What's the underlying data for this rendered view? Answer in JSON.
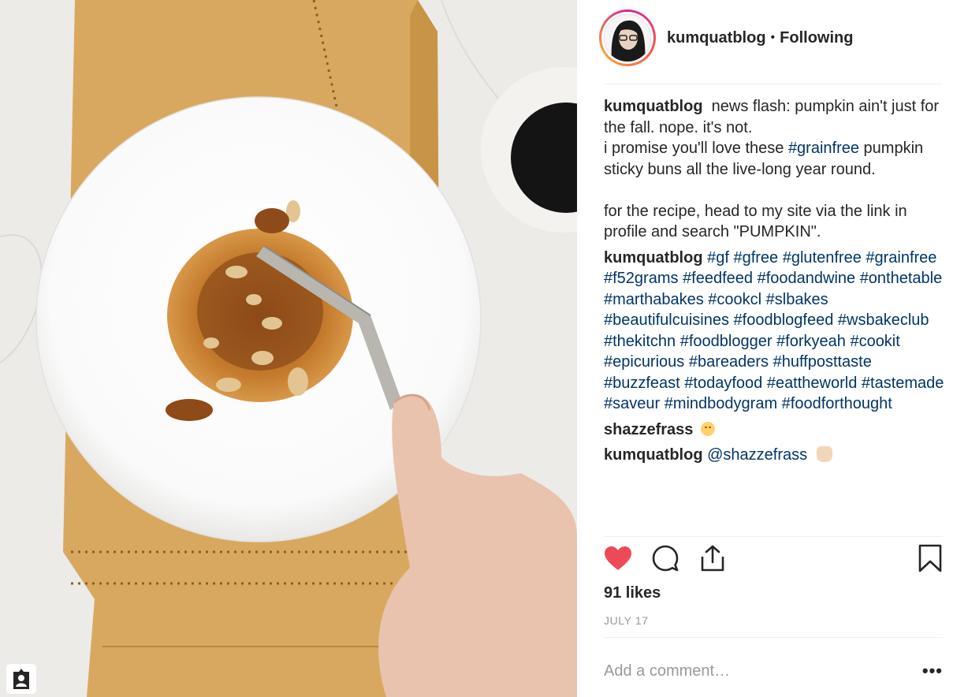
{
  "post": {
    "author": "kumquatblog",
    "follow_status": "Following",
    "separator": "•"
  },
  "comments": [
    {
      "user": "kumquatblog",
      "text": "news flash: pumpkin ain't just for the fall. nope. it's not.\ni promise you'll love these ",
      "hashtag_inline": "#grainfree",
      "text_after": " pumpkin sticky buns all the live-long year round.\n\nfor the recipe, head to my site via the link in profile and search \"PUMPKIN\"."
    },
    {
      "user": "kumquatblog",
      "hashtags": "#gf #gfree #glutenfree #grainfree #f52grams #feedfeed #foodandwine #onthetable #marthabakes #cookcl #slbakes #beautifulcuisines #foodblogfeed #wsbakeclub #thekitchn #foodblogger #forkyeah #cookit #epicurious #bareaders #huffposttaste #buzzfeast #todayfood #eattheworld #tastemade #saveur #mindbodygram #foodforthought"
    },
    {
      "user": "shazzefrass",
      "emoji": "smiling-face-emoji"
    },
    {
      "user": "kumquatblog",
      "mention": "@shazzefrass",
      "emoji": "raised-hands-emoji"
    }
  ],
  "actions": {
    "like_icon": "heart-icon",
    "like_color": "#ed4956",
    "comment_icon": "comment-icon",
    "share_icon": "share-icon",
    "save_icon": "bookmark-icon"
  },
  "likes": "91 likes",
  "date": "JULY 17",
  "comment_input": {
    "placeholder": "Add a comment…"
  },
  "more_options": "•••",
  "photo": {
    "tag_icon": "user-tag-icon"
  },
  "colors": {
    "hashtag": "#003569",
    "border": "#efefef",
    "muted": "#999999"
  }
}
